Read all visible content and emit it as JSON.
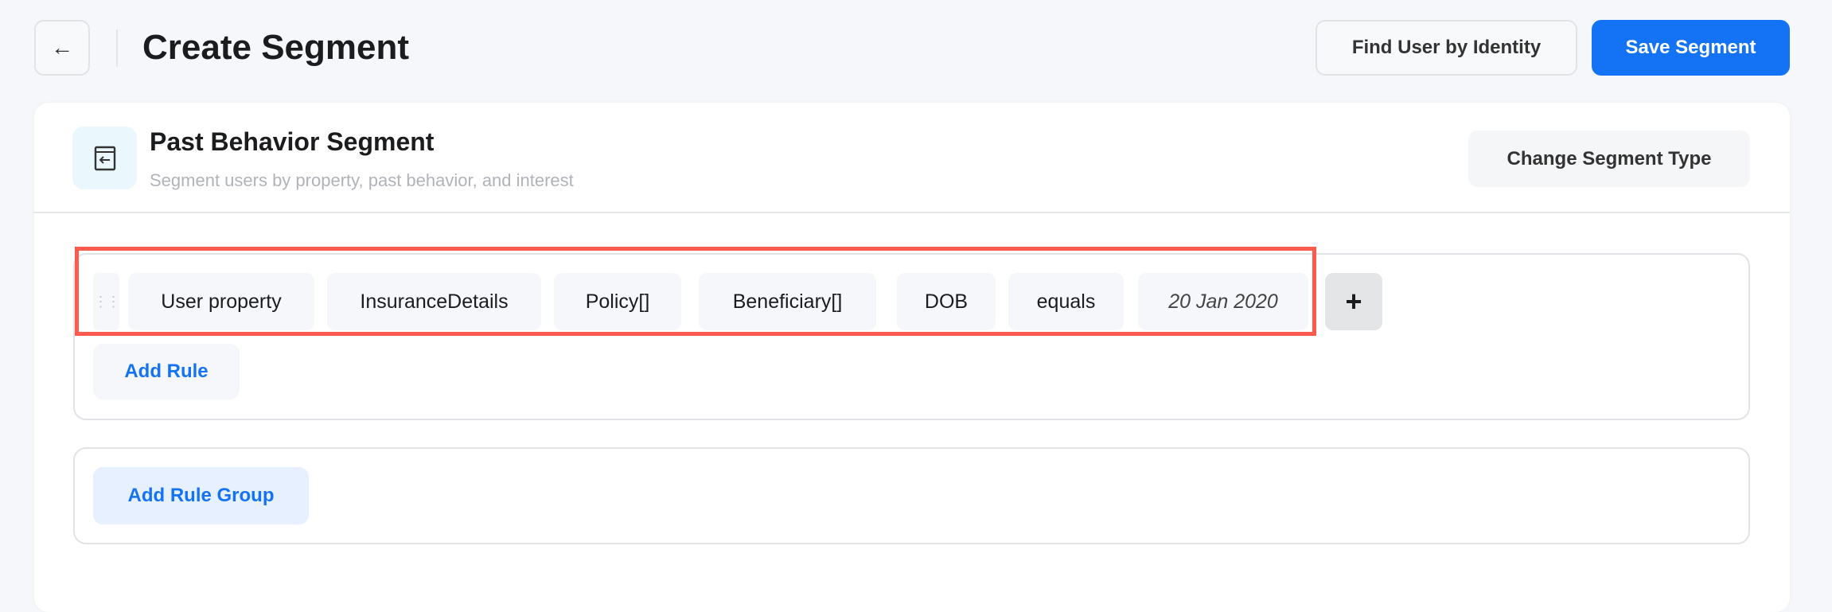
{
  "header": {
    "back_icon": "arrow-left-icon",
    "title": "Create Segment",
    "find_user_label": "Find User by Identity",
    "save_label": "Save Segment"
  },
  "segment": {
    "icon": "window-arrow-left-icon",
    "title": "Past Behavior Segment",
    "subtitle": "Segment users by property, past behavior, and interest",
    "change_type_label": "Change Segment Type"
  },
  "rule": {
    "chips": [
      "User property",
      "InsuranceDetails",
      "Policy[]",
      "Beneficiary[]",
      "DOB",
      "equals",
      "20 Jan 2020"
    ],
    "add_condition_label": "+",
    "add_rule_label": "Add Rule"
  },
  "add_rule_group_label": "Add Rule Group",
  "colors": {
    "accent": "#1473f5",
    "highlight": "#ff5a4d"
  }
}
